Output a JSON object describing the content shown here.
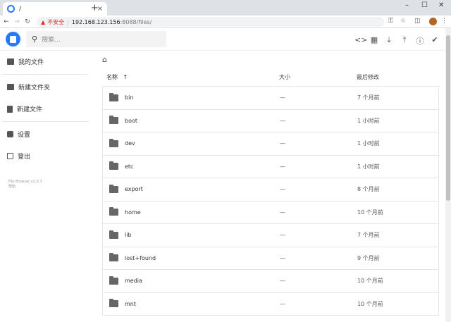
{
  "browser": {
    "tab_title": "/",
    "tab_close": "×",
    "new_tab": "+",
    "window_controls": [
      "–",
      "☐",
      "✕"
    ],
    "insecure_label": "不安全",
    "url_host": "192.168.123.156",
    "url_rest": ":8088/files/"
  },
  "header": {
    "search_placeholder": "搜索..."
  },
  "sidebar": {
    "items": [
      {
        "label": "我的文件",
        "icon": "folder-icon"
      },
      {
        "label": "新建文件夹",
        "icon": "new-folder-icon"
      },
      {
        "label": "新建文件",
        "icon": "new-file-icon"
      },
      {
        "label": "设置",
        "icon": "settings-icon"
      },
      {
        "label": "登出",
        "icon": "logout-icon"
      }
    ],
    "footer_version": "File Browser v2.0.3",
    "footer_help": "帮助"
  },
  "listing": {
    "col_name": "名称",
    "sort_arrow": "↑",
    "col_size": "大小",
    "col_modified": "最后修改",
    "rows": [
      {
        "name": "bin",
        "size": "—",
        "modified": "7 个月前"
      },
      {
        "name": "boot",
        "size": "—",
        "modified": "1 小时前"
      },
      {
        "name": "dev",
        "size": "—",
        "modified": "1 小时前"
      },
      {
        "name": "etc",
        "size": "—",
        "modified": "1 小时前"
      },
      {
        "name": "export",
        "size": "—",
        "modified": "8 个月前"
      },
      {
        "name": "home",
        "size": "—",
        "modified": "10 个月前"
      },
      {
        "name": "lib",
        "size": "—",
        "modified": "7 个月前"
      },
      {
        "name": "lost+found",
        "size": "—",
        "modified": "9 个月前"
      },
      {
        "name": "media",
        "size": "—",
        "modified": "10 个月前"
      },
      {
        "name": "mnt",
        "size": "—",
        "modified": "10 个月前"
      }
    ]
  },
  "colors": {
    "accent": "#2979ff",
    "warning": "#d93025"
  }
}
